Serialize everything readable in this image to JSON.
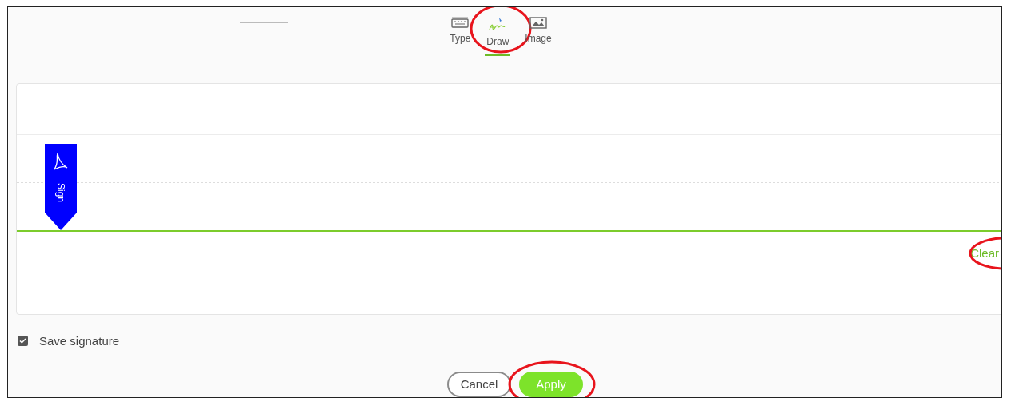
{
  "tabs": [
    {
      "label": "Type",
      "kind": "keyboard",
      "selected": false,
      "circled": false
    },
    {
      "label": "Draw",
      "kind": "draw",
      "selected": true,
      "circled": true
    },
    {
      "label": "Image",
      "kind": "image",
      "selected": false,
      "circled": false
    }
  ],
  "sign_tag": {
    "label": "Sign"
  },
  "clear": {
    "label": "Clear",
    "circled": true
  },
  "save_signature": {
    "label": "Save signature",
    "checked": true
  },
  "buttons": [
    {
      "label": "Cancel",
      "kind": "secondary",
      "circled": false
    },
    {
      "label": "Apply",
      "kind": "primary",
      "circled": true
    }
  ]
}
